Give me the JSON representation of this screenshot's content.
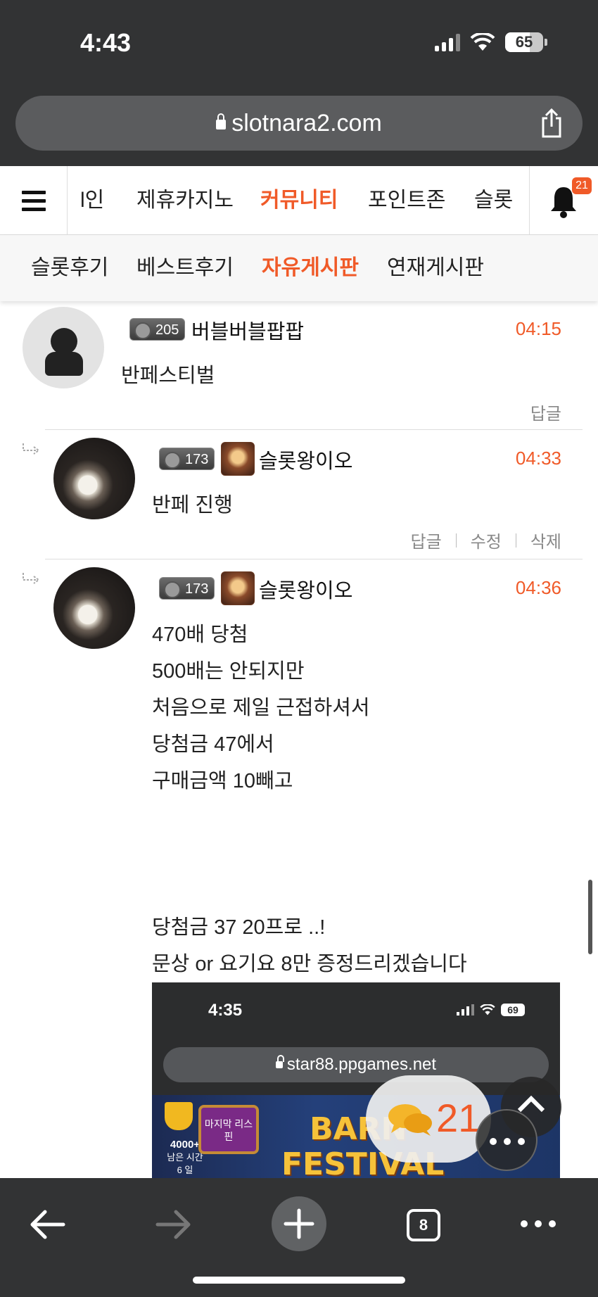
{
  "status_bar": {
    "time": "4:43",
    "battery": "65",
    "battery_level": 0.65
  },
  "browser": {
    "url": "slotnara2.com",
    "tab_count": "8"
  },
  "main_nav": {
    "items": [
      {
        "label": "l인"
      },
      {
        "label": "제휴카지노"
      },
      {
        "label": "커뮤니티",
        "active": true
      },
      {
        "label": "포인트존"
      },
      {
        "label": "슬롯"
      }
    ],
    "notification_count": "21"
  },
  "sub_nav": {
    "items": [
      {
        "label": "슬롯후기"
      },
      {
        "label": "베스트후기"
      },
      {
        "label": "자유게시판",
        "active": true
      },
      {
        "label": "연재게시판"
      }
    ]
  },
  "comments": [
    {
      "level": "205",
      "nickname": "버블버블팝팝",
      "time": "04:15",
      "lines": [
        "반페스티벌"
      ],
      "actions": [
        "답글"
      ]
    },
    {
      "level": "173",
      "nickname": "슬롯왕이오",
      "time": "04:33",
      "lines": [
        "반페 진행"
      ],
      "actions": [
        "답글",
        "수정",
        "삭제"
      ]
    },
    {
      "level": "173",
      "nickname": "슬롯왕이오",
      "time": "04:36",
      "lines": [
        "470배 당첨",
        "500배는 안되지만",
        "처음으로 제일 근접하셔서",
        "당첨금 47에서",
        "구매금액 10빼고",
        "당첨금 37 20프로 ..!",
        "문상 or 요기요 8만 증정드리겠습니다"
      ],
      "actions": []
    }
  ],
  "embedded_screenshot": {
    "time": "4:35",
    "battery": "69",
    "url": "star88.ppgames.net",
    "banner_left_value": "4000+",
    "banner_left_label": "남은 시간",
    "banner_left_sub": "6 일",
    "banner_magic": "마지막 리스핀",
    "banner_title_1": "BARN",
    "banner_title_2": "FESTIVAL"
  },
  "floating": {
    "chat_count": "21"
  }
}
